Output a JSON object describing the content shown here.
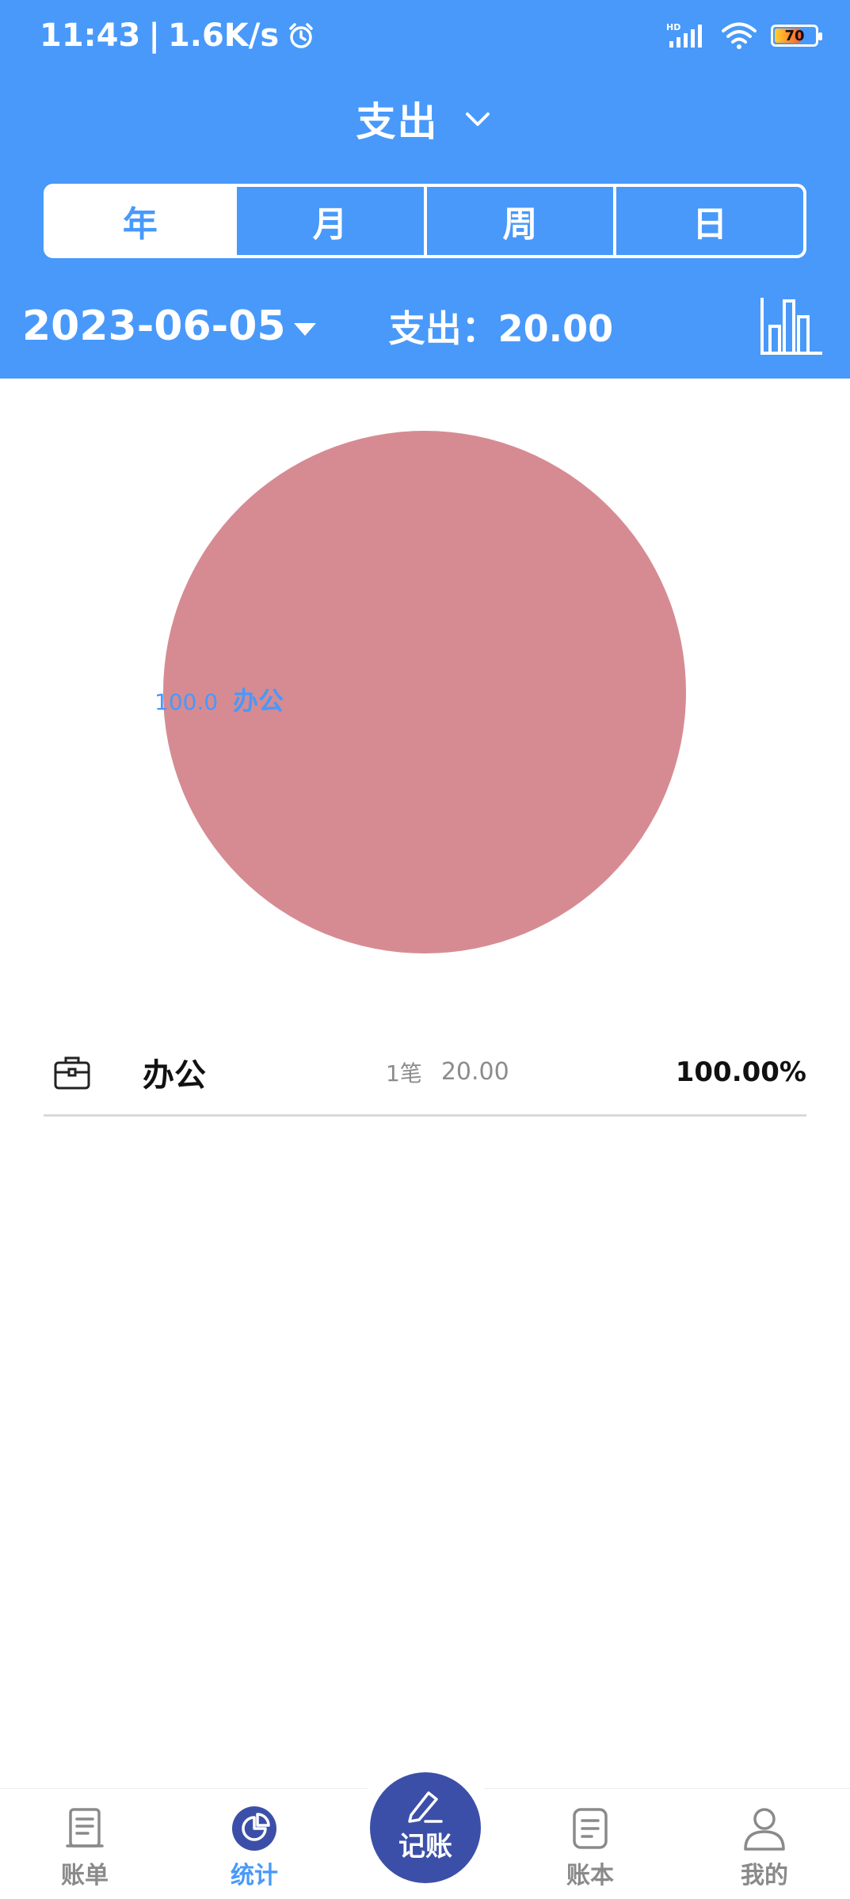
{
  "status_bar": {
    "time": "11:43",
    "speed": "1.6K/s",
    "battery": "70"
  },
  "header": {
    "title": "支出",
    "period_tabs": [
      {
        "label": "年",
        "active": true
      },
      {
        "label": "月",
        "active": false
      },
      {
        "label": "周",
        "active": false
      },
      {
        "label": "日",
        "active": false
      }
    ],
    "date": "2023-06-05",
    "total_label": "支出：",
    "total_value": "20.00"
  },
  "colors": {
    "primary": "#4899fa",
    "pie_slice": "#d68b92",
    "fab": "#3c4fa8"
  },
  "chart_data": {
    "type": "pie",
    "slices": [
      {
        "label": "办公",
        "value": 100.0,
        "color": "#d68b92"
      }
    ],
    "data_label_value": "100.0",
    "data_label_name": "办公"
  },
  "category_list": [
    {
      "icon": "briefcase-icon",
      "name": "办公",
      "count": "1笔",
      "amount": "20.00",
      "percent": "100.00%"
    }
  ],
  "tabbar": {
    "items": [
      {
        "label": "账单",
        "icon": "bill-icon",
        "active": false
      },
      {
        "label": "统计",
        "icon": "pie-chart-icon",
        "active": true
      },
      {
        "label": "记账",
        "icon": "pencil-icon",
        "active": false
      },
      {
        "label": "账本",
        "icon": "ledger-icon",
        "active": false
      },
      {
        "label": "我的",
        "icon": "user-icon",
        "active": false
      }
    ]
  }
}
